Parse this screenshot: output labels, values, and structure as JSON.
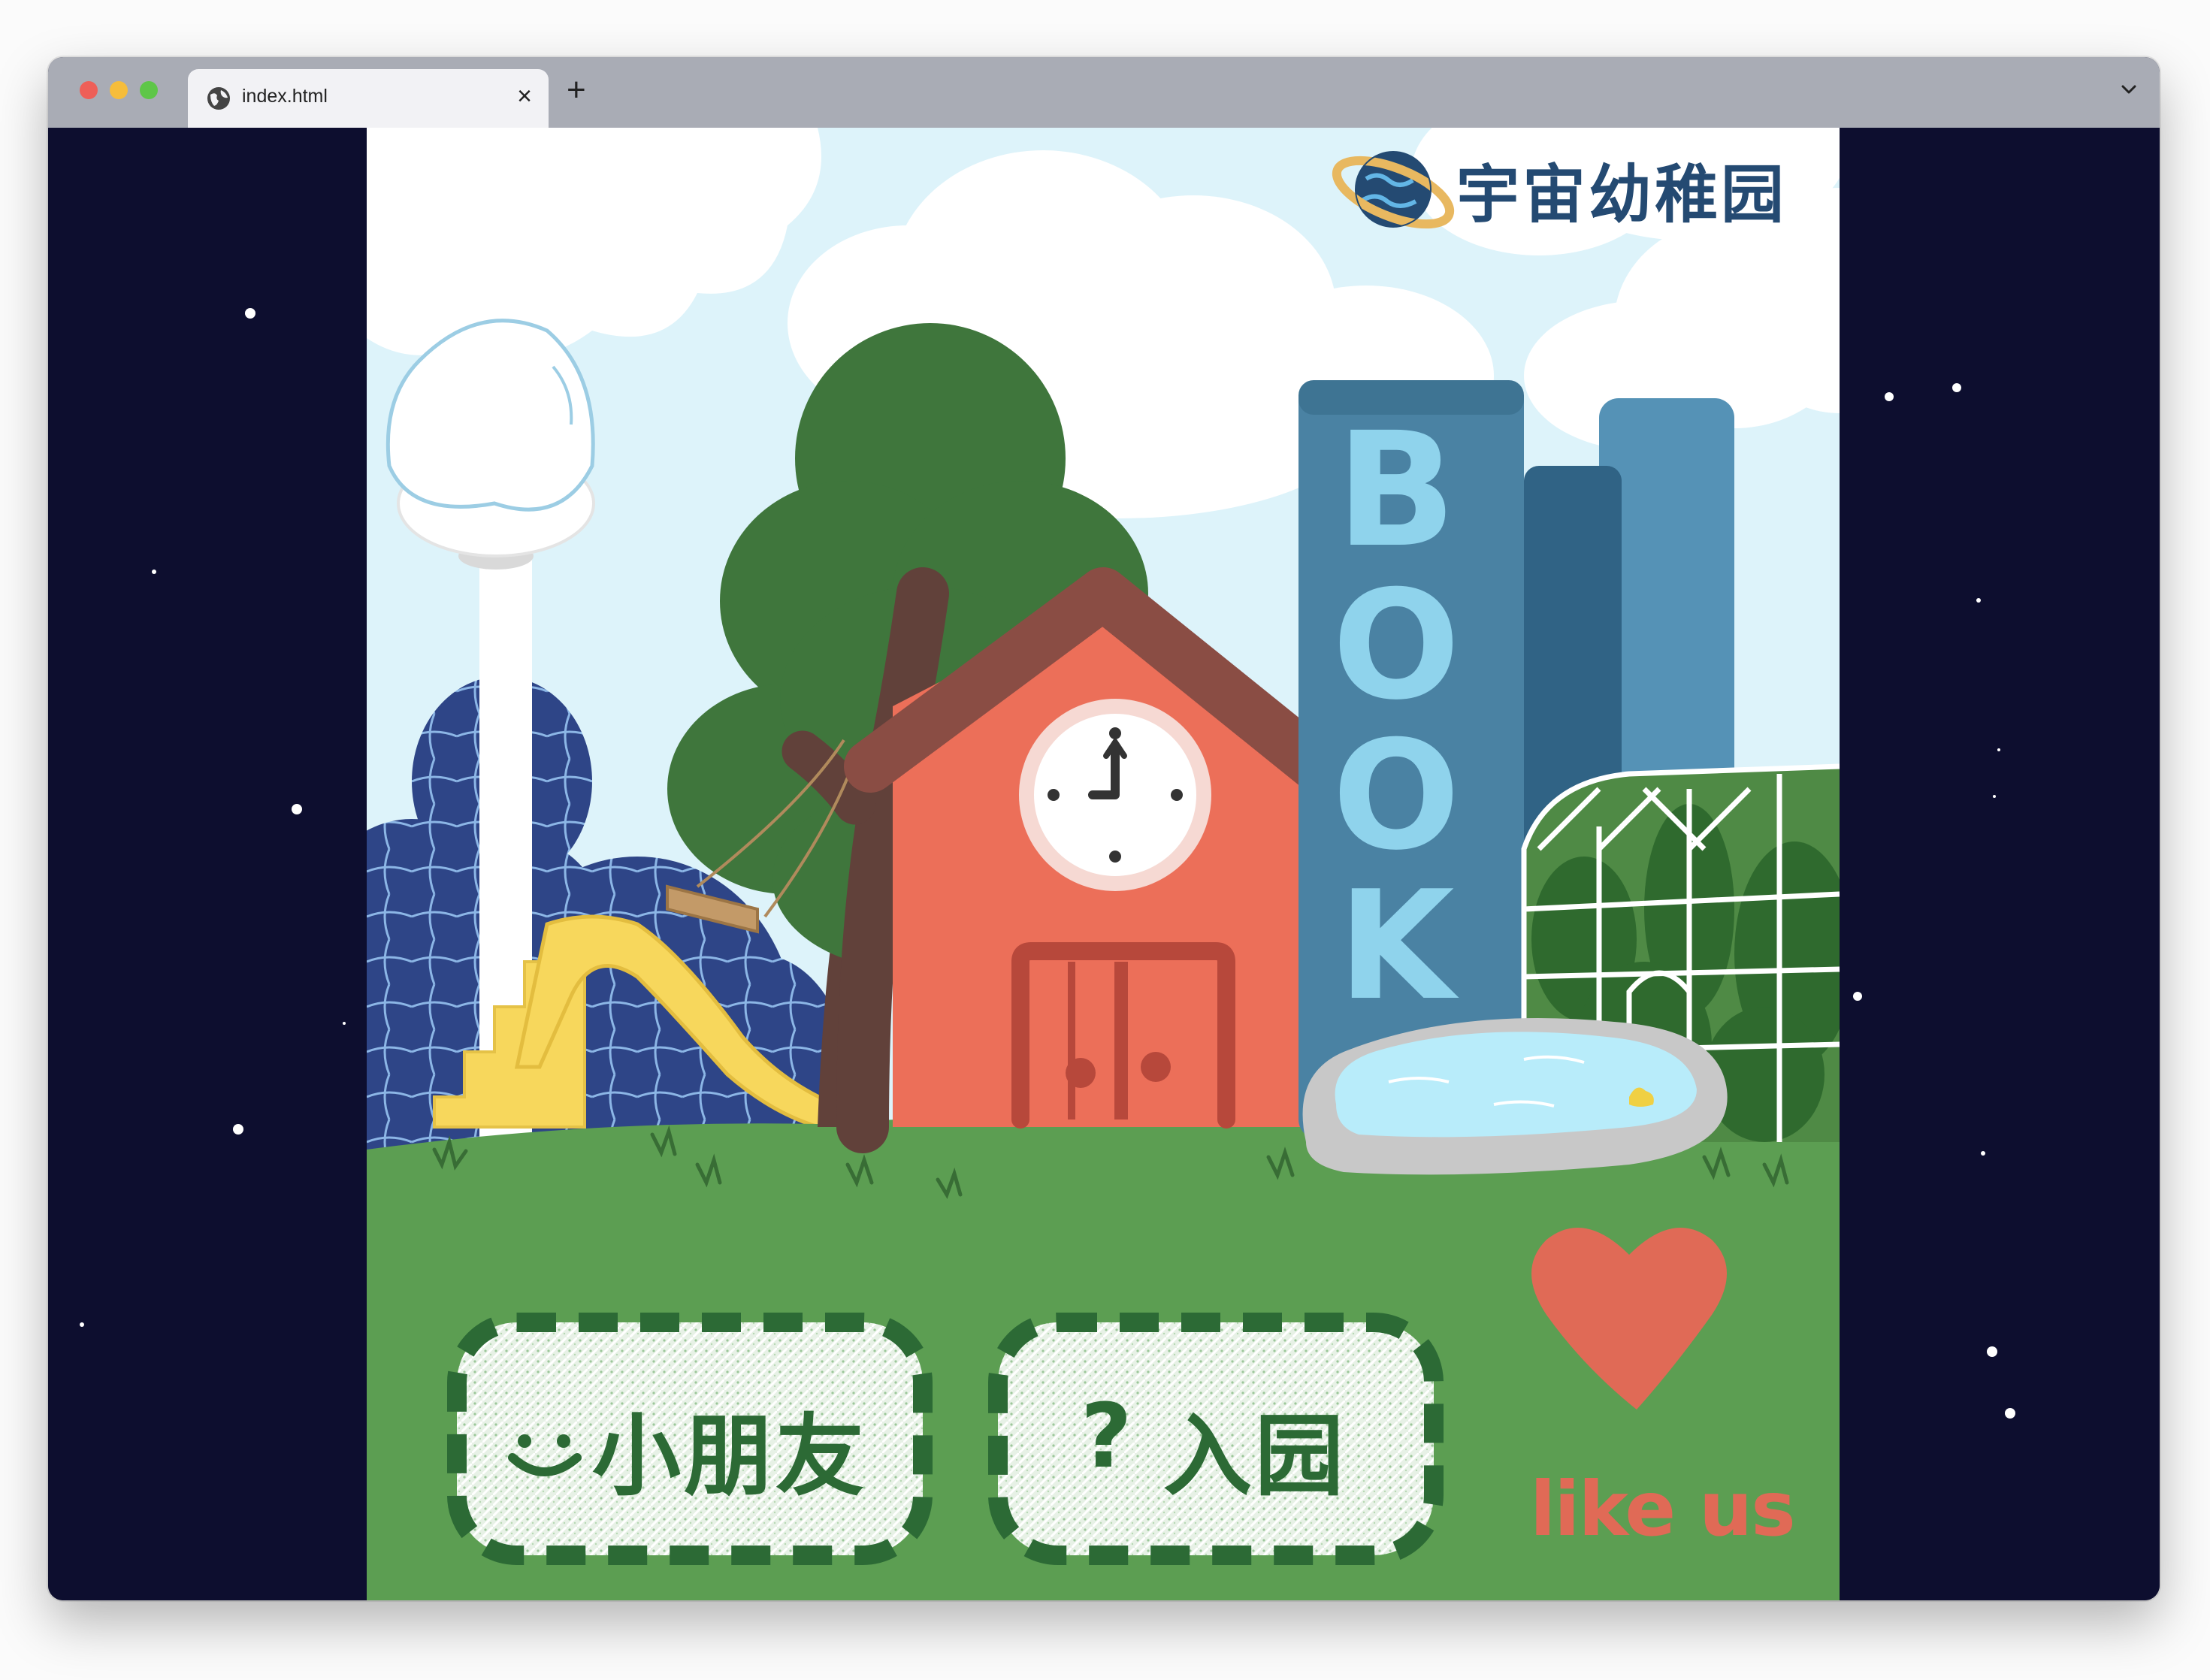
{
  "browser": {
    "tab_title": "index.html",
    "tab_close": "×",
    "new_tab": "+"
  },
  "colors": {
    "tabbar": "#a9acb5",
    "space": "#0d0e2f",
    "sky": "#ddf3fa",
    "grass": "#5c9e52",
    "house": "#ec6f59",
    "roof": "#8a4d44",
    "book": "#4a82a3",
    "book_letters": "#8fd3ec",
    "slide": "#f7d75c",
    "tree": "#3f763c",
    "globe": "#2e4587",
    "accent_red": "#e06a56",
    "button_text": "#2c6a35"
  },
  "scene": {
    "logo_text": "宇宙幼稚园",
    "book_letters": [
      "B",
      "O",
      "O",
      "K"
    ],
    "buttons": {
      "kids_icon": "◡̈",
      "kids_label": "小朋友",
      "enter_icon": "?",
      "enter_label": "入园"
    },
    "like_text": "like us"
  },
  "icons": [
    "globe-icon",
    "chevron-down-icon",
    "planet-logo-icon",
    "smiley-icon",
    "question-icon",
    "heart-icon"
  ]
}
